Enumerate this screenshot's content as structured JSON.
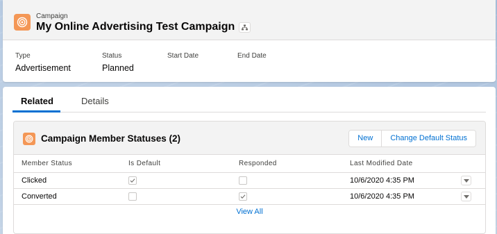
{
  "header": {
    "record_type": "Campaign",
    "title": "My Online Advertising Test Campaign",
    "icon": "campaign-target-icon",
    "accent_color": "#f49756",
    "fields": [
      {
        "label": "Type",
        "value": "Advertisement"
      },
      {
        "label": "Status",
        "value": "Planned"
      },
      {
        "label": "Start Date",
        "value": ""
      },
      {
        "label": "End Date",
        "value": ""
      }
    ]
  },
  "tabs": [
    {
      "label": "Related",
      "active": true
    },
    {
      "label": "Details",
      "active": false
    }
  ],
  "related_list": {
    "title": "Campaign Member Statuses (2)",
    "buttons": {
      "new": "New",
      "change_default": "Change Default Status"
    },
    "columns": [
      "Member Status",
      "Is Default",
      "Responded",
      "Last Modified Date"
    ],
    "rows": [
      {
        "member_status": "Clicked",
        "is_default": true,
        "responded": false,
        "last_modified": "10/6/2020 4:35 PM"
      },
      {
        "member_status": "Converted",
        "is_default": false,
        "responded": true,
        "last_modified": "10/6/2020 4:35 PM"
      }
    ],
    "view_all": "View All"
  },
  "colors": {
    "link": "#0070d2",
    "tab_active": "#0070d2",
    "icon_bg": "#f49756"
  }
}
